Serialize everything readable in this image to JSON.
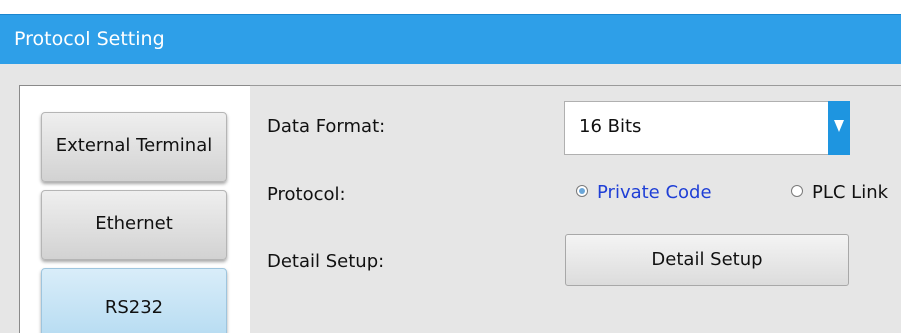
{
  "window": {
    "title": "Protocol Setting"
  },
  "sidebar": {
    "items": [
      {
        "label": "External Terminal",
        "active": false
      },
      {
        "label": "Ethernet",
        "active": false
      },
      {
        "label": "RS232",
        "active": true
      }
    ]
  },
  "form": {
    "data_format": {
      "label": "Data Format:",
      "value": "16 Bits"
    },
    "protocol": {
      "label": "Protocol:",
      "options": [
        {
          "label": "Private Code",
          "selected": true
        },
        {
          "label": "PLC Link",
          "selected": false
        }
      ]
    },
    "detail_setup": {
      "label": "Detail Setup:",
      "button_label": "Detail Setup"
    }
  },
  "icons": {
    "dropdown_arrow": "chevron-down-icon"
  },
  "colors": {
    "title_bar": "#2e9fe8",
    "dropdown_arrow": "#1e95e0",
    "selected_radio_text": "#1f3fd6",
    "active_tab": "#b7dcf2"
  }
}
